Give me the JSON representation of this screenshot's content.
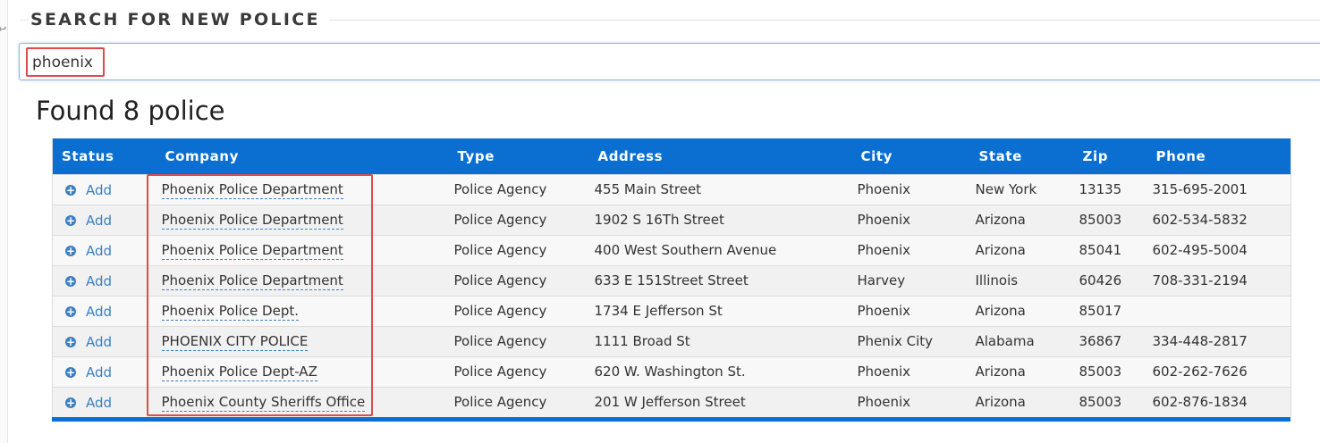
{
  "section": {
    "title": "SEARCH FOR NEW POLICE"
  },
  "search": {
    "value": "phoenix"
  },
  "results": {
    "heading": "Found 8 police"
  },
  "table": {
    "columns": [
      "Status",
      "Company",
      "Type",
      "Address",
      "City",
      "State",
      "Zip",
      "Phone"
    ],
    "add_label": "Add",
    "rows": [
      {
        "company": "Phoenix Police Department",
        "type": "Police Agency",
        "address": "455 Main Street",
        "city": "Phoenix",
        "state": "New York",
        "zip": "13135",
        "phone": "315-695-2001"
      },
      {
        "company": "Phoenix Police Department",
        "type": "Police Agency",
        "address": "1902 S 16Th Street",
        "city": "Phoenix",
        "state": "Arizona",
        "zip": "85003",
        "phone": "602-534-5832"
      },
      {
        "company": "Phoenix Police Department",
        "type": "Police Agency",
        "address": "400 West Southern Avenue",
        "city": "Phoenix",
        "state": "Arizona",
        "zip": "85041",
        "phone": "602-495-5004"
      },
      {
        "company": "Phoenix Police Department",
        "type": "Police Agency",
        "address": "633 E 151Street Street",
        "city": "Harvey",
        "state": "Illinois",
        "zip": "60426",
        "phone": "708-331-2194"
      },
      {
        "company": "Phoenix Police Dept.",
        "type": "Police Agency",
        "address": "1734 E Jefferson St",
        "city": "Phoenix",
        "state": "Arizona",
        "zip": "85017",
        "phone": ""
      },
      {
        "company": "PHOENIX CITY POLICE",
        "type": "Police Agency",
        "address": "1111 Broad St",
        "city": "Phenix City",
        "state": "Alabama",
        "zip": "36867",
        "phone": "334-448-2817"
      },
      {
        "company": "Phoenix Police Dept-AZ",
        "type": "Police Agency",
        "address": "620 W. Washington St.",
        "city": "Phoenix",
        "state": "Arizona",
        "zip": "85003",
        "phone": "602-262-7626"
      },
      {
        "company": "Phoenix County Sheriffs Office",
        "type": "Police Agency",
        "address": "201 W Jefferson Street",
        "city": "Phoenix",
        "state": "Arizona",
        "zip": "85003",
        "phone": "602-876-1834"
      }
    ]
  },
  "colors": {
    "header_blue": "#0a6fd0",
    "link_blue": "#3d7fc0",
    "highlight_red": "#e04a4a"
  },
  "icons": {
    "add": "plus-circle-icon"
  }
}
